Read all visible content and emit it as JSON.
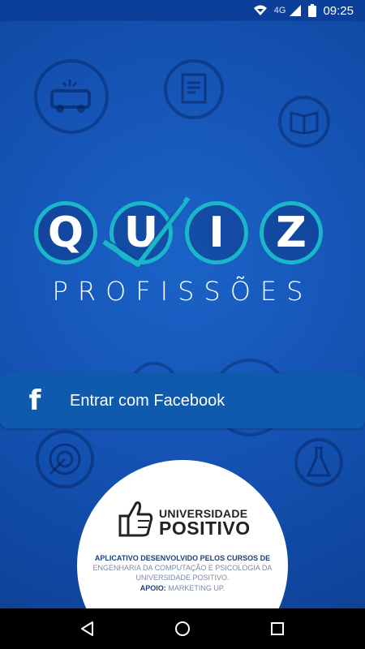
{
  "status_bar": {
    "network": "4G",
    "time": "09:25",
    "icons": [
      "signal-extra-icon",
      "network-signal-icon",
      "battery-icon"
    ]
  },
  "logo": {
    "letters": [
      "Q",
      "U",
      "I",
      "Z"
    ],
    "subtitle": "PROFISSÕES",
    "accent_color": "#1ab6c9"
  },
  "login": {
    "button_label": "Entrar com Facebook",
    "icon": "f"
  },
  "university": {
    "name_line1": "UNIVERSIDADE",
    "name_line2": "POSITIVO",
    "description_bold": "APLICATIVO DESENVOLVIDO PELOS CURSOS DE",
    "description_rest": "ENGENHARIA DA COMPUTAÇÃO E PSICOLOGIA DA UNIVERSIDADE POSITIVO.",
    "support_label": "APOIO:",
    "support_value": "MARKETING UP."
  },
  "nav_bar": {
    "buttons": [
      "back-icon",
      "home-icon",
      "recents-icon"
    ]
  },
  "colors": {
    "background": "#1553b4",
    "button_bg": "#0f5aad",
    "status_bar": "#0b3f99"
  }
}
